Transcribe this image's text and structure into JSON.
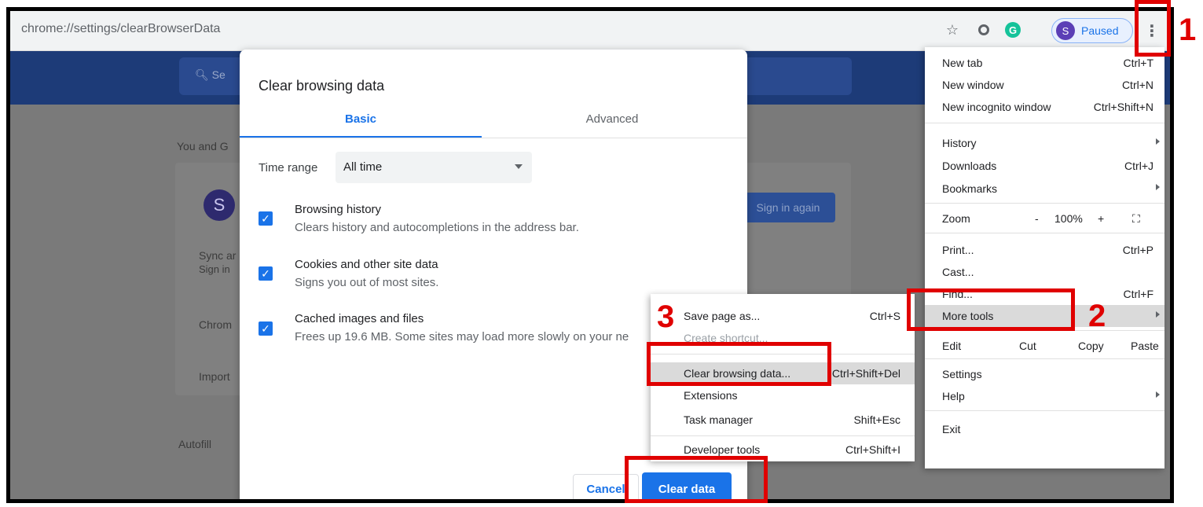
{
  "browser": {
    "url": "chrome://settings/clearBrowserData",
    "profile_initial": "S",
    "profile_status": "Paused",
    "extension_letter": "G",
    "icons": [
      "star-icon",
      "extension-icon",
      "grammarly-icon",
      "more-vert-icon"
    ]
  },
  "settings_bg": {
    "search_text": "Se",
    "section_you": "You and G",
    "avatar_initial": "S",
    "sign_in_again": "Sign in again",
    "sync_label": "Sync ar",
    "sync_sub": "Sign in",
    "chrome_label": "Chrom",
    "import_label": "Import",
    "autofill_label": "Autofill"
  },
  "dialog": {
    "title": "Clear browsing data",
    "tabs": [
      "Basic",
      "Advanced"
    ],
    "time_range_label": "Time range",
    "time_range_value": "All time",
    "options": [
      {
        "title": "Browsing history",
        "desc": "Clears history and autocompletions in the address bar.",
        "checked": true
      },
      {
        "title": "Cookies and other site data",
        "desc": "Signs you out of most sites.",
        "checked": true
      },
      {
        "title": "Cached images and files",
        "desc": "Frees up 19.6 MB. Some sites may load more slowly on your ne",
        "checked": true
      }
    ],
    "cancel": "Cancel",
    "clear": "Clear data"
  },
  "menu": {
    "new_tab": "New tab",
    "new_tab_key": "Ctrl+T",
    "new_window": "New window",
    "new_window_key": "Ctrl+N",
    "incognito": "New incognito window",
    "incognito_key": "Ctrl+Shift+N",
    "history": "History",
    "downloads": "Downloads",
    "downloads_key": "Ctrl+J",
    "bookmarks": "Bookmarks",
    "zoom": "Zoom",
    "zoom_minus": "-",
    "zoom_value": "100%",
    "zoom_plus": "+",
    "fullscreen_glyph": "⛶",
    "print": "Print...",
    "print_key": "Ctrl+P",
    "cast": "Cast...",
    "find": "Find...",
    "find_key": "Ctrl+F",
    "more_tools": "More tools",
    "edit": "Edit",
    "cut": "Cut",
    "copy": "Copy",
    "paste": "Paste",
    "settings": "Settings",
    "help": "Help",
    "exit": "Exit"
  },
  "submenu": {
    "save_page": "Save page as...",
    "save_page_key": "Ctrl+S",
    "create_shortcut": "Create shortcut...",
    "clear_browsing": "Clear browsing data...",
    "clear_browsing_key": "Ctrl+Shift+Del",
    "extensions": "Extensions",
    "task_manager": "Task manager",
    "task_manager_key": "Shift+Esc",
    "dev_tools": "Developer tools",
    "dev_tools_key": "Ctrl+Shift+I"
  },
  "annotations": {
    "step1": "1",
    "step2": "2",
    "step3": "3",
    "color": "#e00000"
  }
}
